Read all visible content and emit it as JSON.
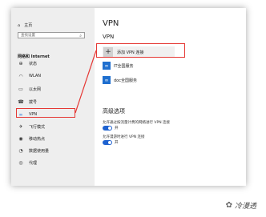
{
  "sidebar": {
    "home_label": "主页",
    "search_placeholder": "查找设置",
    "section_label": "网络和 Internet",
    "items": [
      {
        "label": "状态",
        "icon": "globe-icon"
      },
      {
        "label": "WLAN",
        "icon": "wifi-icon"
      },
      {
        "label": "以太网",
        "icon": "ethernet-icon"
      },
      {
        "label": "拨号",
        "icon": "phone-icon"
      },
      {
        "label": "VPN",
        "icon": "vpn-icon",
        "active": true
      },
      {
        "label": "飞行模式",
        "icon": "airplane-icon"
      },
      {
        "label": "移动热点",
        "icon": "hotspot-icon"
      },
      {
        "label": "数据使用量",
        "icon": "data-usage-icon"
      },
      {
        "label": "代理",
        "icon": "proxy-icon"
      }
    ]
  },
  "main": {
    "page_title": "VPN",
    "sub_title": "VPN",
    "add_vpn_label": "添加 VPN 连接",
    "vpn_connections": [
      {
        "label": "IT全国服务"
      },
      {
        "label": "doc全国服务"
      }
    ],
    "advanced_title": "高级选项",
    "options": [
      {
        "label": "允许通过按流量计费的网络进行 VPN 连接",
        "state": "开"
      },
      {
        "label": "允许漫游时进行 VPN 连接",
        "state": "开"
      }
    ]
  },
  "watermark": {
    "text": "冷漫透"
  },
  "colors": {
    "accent": "#1e62d0",
    "highlight": "#e53935"
  }
}
